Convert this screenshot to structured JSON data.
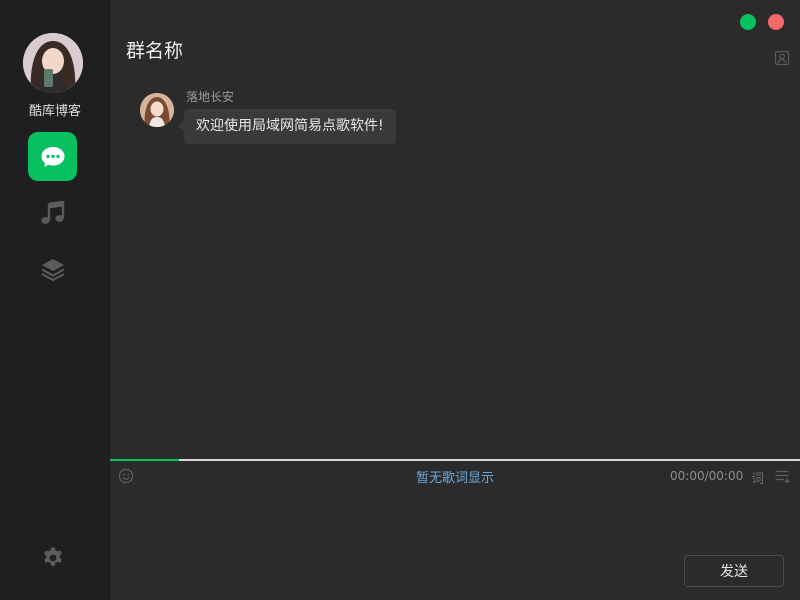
{
  "sidebar": {
    "user_name": "酷库博客",
    "nav": [
      {
        "id": "chat",
        "icon": "chat-bubble-icon",
        "active": true
      },
      {
        "id": "music",
        "icon": "music-note-icon",
        "active": false
      },
      {
        "id": "layers",
        "icon": "layers-icon",
        "active": false
      }
    ],
    "settings_icon": "gear-icon"
  },
  "header": {
    "title": "群名称"
  },
  "messages": [
    {
      "sender": "落地长安",
      "text": "欢迎使用局域网简易点歌软件!"
    }
  ],
  "player": {
    "lyrics_text": "暂无歌词显示",
    "time": "00:00/00:00",
    "lyric_toggle": "词",
    "progress": 0.1
  },
  "composer": {
    "input_value": "",
    "send_label": "发送"
  },
  "colors": {
    "accent": "#07c160",
    "close": "#f1696b",
    "sidebar_bg": "#1f1f21",
    "main_bg": "#2b2b2b",
    "bubble_bg": "#3a3a3a",
    "lyrics": "#6fa8dc"
  }
}
